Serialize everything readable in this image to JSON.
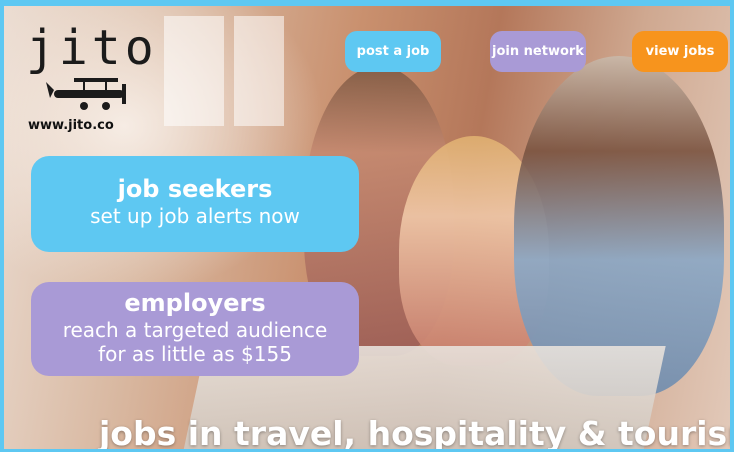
{
  "brand": {
    "logo_text": "jito",
    "url": "www.jito.co"
  },
  "nav": {
    "post_job": "post a job",
    "join_network": "join network",
    "view_jobs": "view jobs"
  },
  "seekers": {
    "title": "job seekers",
    "subtitle": "set up job alerts now"
  },
  "employers": {
    "title": "employers",
    "line1": "reach a targeted audience",
    "line2": "for as little as $155"
  },
  "tagline": "jobs in travel, hospitality & tourism",
  "colors": {
    "blue": "#5ec8f2",
    "purple": "#a99ad6",
    "orange": "#f7941d",
    "white": "#ffffff"
  }
}
